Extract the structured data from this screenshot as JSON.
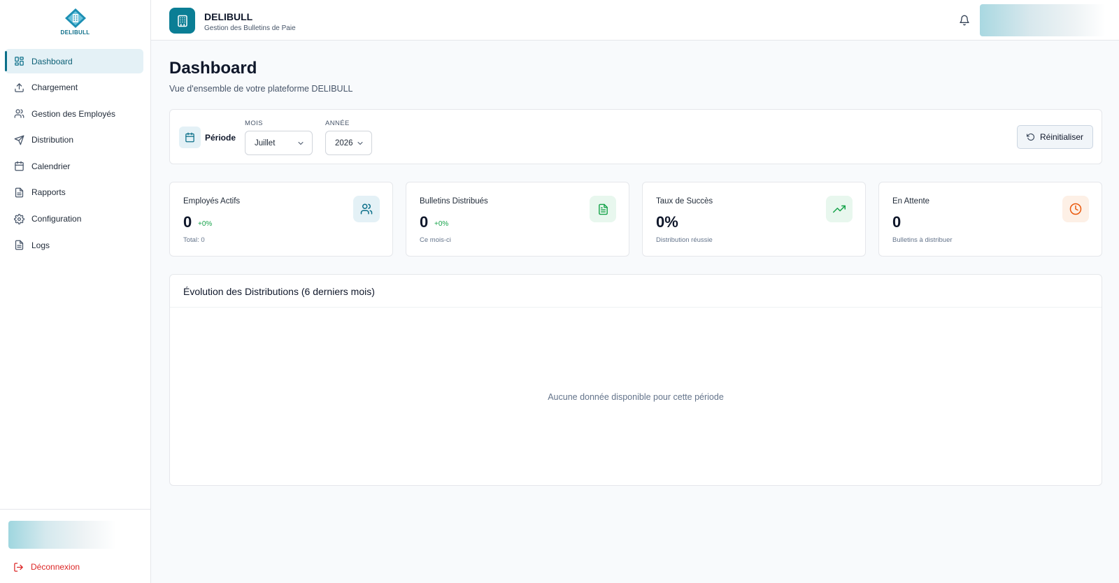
{
  "app": {
    "logo_text": "DELIBULL",
    "title": "DELIBULL",
    "subtitle": "Gestion des Bulletins de Paie"
  },
  "sidebar": {
    "items": [
      {
        "label": "Dashboard",
        "icon": "dashboard-icon",
        "active": true
      },
      {
        "label": "Chargement",
        "icon": "upload-icon",
        "active": false
      },
      {
        "label": "Gestion des Employés",
        "icon": "users-icon",
        "active": false
      },
      {
        "label": "Distribution",
        "icon": "send-icon",
        "active": false
      },
      {
        "label": "Calendrier",
        "icon": "calendar-icon",
        "active": false
      },
      {
        "label": "Rapports",
        "icon": "file-icon",
        "active": false
      },
      {
        "label": "Configuration",
        "icon": "gear-icon",
        "active": false
      },
      {
        "label": "Logs",
        "icon": "file-icon",
        "active": false
      }
    ],
    "logout_label": "Déconnexion"
  },
  "page": {
    "title": "Dashboard",
    "subtitle": "Vue d'ensemble de votre plateforme DELIBULL"
  },
  "filters": {
    "period_label": "Période",
    "month_label": "MOIS",
    "month_value": "Juillet",
    "year_label": "ANNÉE",
    "year_value": "2026",
    "reset_label": "Réinitialiser"
  },
  "stats": [
    {
      "label": "Employés Actifs",
      "value": "0",
      "delta": "+0%",
      "note": "Total: 0",
      "icon": "users-icon",
      "color": "#0b6f89",
      "bg": "#e4f1f6"
    },
    {
      "label": "Bulletins Distribués",
      "value": "0",
      "delta": "+0%",
      "note": "Ce mois-ci",
      "icon": "document-icon",
      "color": "#16a34a",
      "bg": "#e8f7ee"
    },
    {
      "label": "Taux de Succès",
      "value": "0%",
      "delta": "",
      "note": "Distribution réussie",
      "icon": "trending-up-icon",
      "color": "#16a34a",
      "bg": "#e8f7ee"
    },
    {
      "label": "En Attente",
      "value": "0",
      "delta": "",
      "note": "Bulletins à distribuer",
      "icon": "clock-icon",
      "color": "#ea580c",
      "bg": "#fdf0e6"
    }
  ],
  "chart": {
    "title": "Évolution des Distributions (6 derniers mois)",
    "empty_message": "Aucune donnée disponible pour cette période"
  }
}
